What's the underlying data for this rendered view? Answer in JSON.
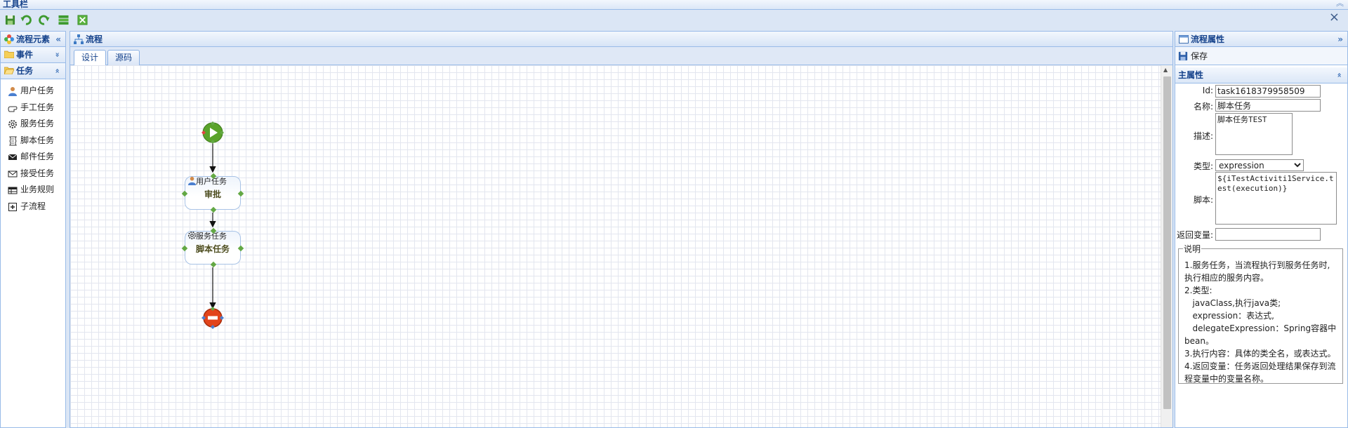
{
  "window": {
    "title": "工具栏",
    "close_glyph": "×"
  },
  "toolbar": {
    "buttons": [
      {
        "name": "save-icon",
        "label": "保存"
      },
      {
        "name": "undo-icon",
        "label": "撤销"
      },
      {
        "name": "redo-icon",
        "label": "重做"
      },
      {
        "name": "layers-icon",
        "label": "图层"
      },
      {
        "name": "close-box-icon",
        "label": "关闭"
      }
    ]
  },
  "left_panel": {
    "title": "流程元素",
    "collapse_glyph": "«",
    "sections": {
      "event": {
        "label": "事件",
        "toggle": "»"
      },
      "task": {
        "label": "任务",
        "toggle": "«"
      }
    },
    "task_items": [
      {
        "label": "用户任务",
        "icon": "user-icon"
      },
      {
        "label": "手工任务",
        "icon": "hand-icon"
      },
      {
        "label": "服务任务",
        "icon": "gear-icon"
      },
      {
        "label": "脚本任务",
        "icon": "script-icon"
      },
      {
        "label": "邮件任务",
        "icon": "mail-icon"
      },
      {
        "label": "接受任务",
        "icon": "receive-mail-icon"
      },
      {
        "label": "业务规则",
        "icon": "table-icon"
      },
      {
        "label": "子流程",
        "icon": "plus-box-icon"
      }
    ]
  },
  "center_panel": {
    "title": "流程",
    "tabs": [
      {
        "label": "设计",
        "active": true
      },
      {
        "label": "源码",
        "active": false
      }
    ],
    "diagram": {
      "start_event": "start-event",
      "nodes": [
        {
          "type_label": "用户任务",
          "name": "审批",
          "icon": "user-icon"
        },
        {
          "type_label": "服务任务",
          "name": "脚本任务",
          "icon": "gear-icon"
        }
      ],
      "end_event": "end-event"
    }
  },
  "right_panel": {
    "title": "流程属性",
    "collapse_glyph": "»",
    "save_label": "保存",
    "section_title": "主属性",
    "section_toggle": "«",
    "fields": {
      "id": {
        "label": "Id:",
        "value": "task1618379958509"
      },
      "name": {
        "label": "名称:",
        "value": "脚本任务"
      },
      "description": {
        "label": "描述:",
        "value": "脚本任务TEST"
      },
      "type": {
        "label": "类型:",
        "value": "expression"
      },
      "script": {
        "label": "脚本:",
        "value": "${iTestActiviti1Service.test(execution)}"
      },
      "return_var": {
        "label": "返回变量:",
        "value": ""
      }
    },
    "explanation": {
      "legend": "说明",
      "lines": [
        "1.服务任务，当流程执行到服务任务时,",
        "执行相应的服务内容。",
        "2.类型:",
        "   javaClass,执行java类;",
        "   expression：表达式,",
        "   delegateExpression：Spring容器中",
        "bean。",
        "3.执行内容：具体的类全名，或表达式。",
        "4.返回变量：任务返回处理结果保存到流",
        "程变量中的变量名称。"
      ]
    }
  },
  "colors": {
    "panel_border": "#99bbe8",
    "header_text": "#15428b",
    "toolbar_bg": "#dbe6f5",
    "start_event": "#5aa32a",
    "end_event": "#e2441b"
  }
}
